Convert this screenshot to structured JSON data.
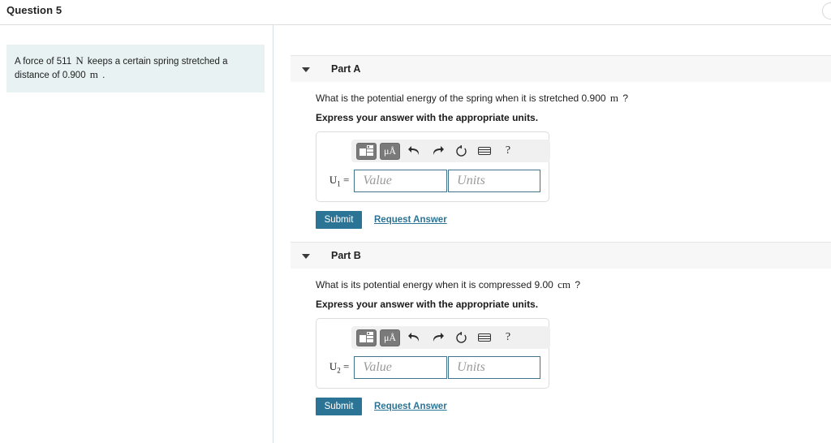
{
  "header": {
    "title": "Question 5",
    "spinner_icon": "circle-loading-icon"
  },
  "problem": {
    "text_before": "A force of 511",
    "unit_force": "N",
    "text_middle": "keeps a certain spring stretched a distance of 0.900",
    "unit_distance": "m",
    "text_end": "."
  },
  "toolbar": {
    "template_icon": "math-template-icon",
    "units_icon": "micro-angstrom-units-icon",
    "undo_icon": "undo-arrow-icon",
    "redo_icon": "redo-arrow-icon",
    "reset_icon": "reset-circular-arrow-icon",
    "keyboard_icon": "keyboard-icon",
    "help_icon": "help-question-mark-icon",
    "help_label": "?"
  },
  "fields": {
    "value_placeholder": "Value",
    "units_placeholder": "Units"
  },
  "actions": {
    "submit_label": "Submit",
    "request_answer_label": "Request Answer"
  },
  "colors": {
    "accent": "#2c7496",
    "field_border": "#41738c",
    "problem_bg": "#e9f2f3",
    "part_header_bg": "#f7f7f7",
    "toolbar_bg": "#f0f0f0",
    "tool_button_dark": "#7a7a7a"
  },
  "parts": [
    {
      "caret_icon": "caret-down-icon",
      "label": "Part A",
      "question": "What is the potential energy of the spring when it is stretched 0.900",
      "question_unit": "m",
      "question_tail": "?",
      "instruction": "Express your answer with the appropriate units.",
      "variable": "U",
      "variable_sub": "1",
      "variable_eq": "="
    },
    {
      "caret_icon": "caret-down-icon",
      "label": "Part B",
      "question": "What is its potential energy when it is compressed 9.00",
      "question_unit": "cm",
      "question_tail": "?",
      "instruction": "Express your answer with the appropriate units.",
      "variable": "U",
      "variable_sub": "2",
      "variable_eq": "="
    }
  ]
}
